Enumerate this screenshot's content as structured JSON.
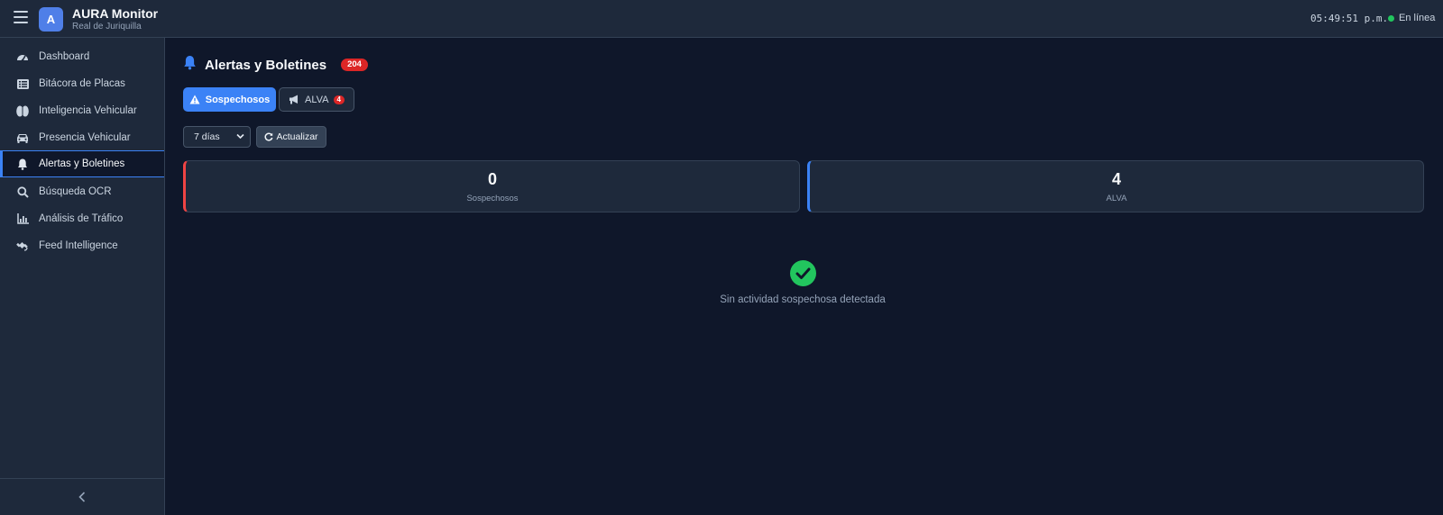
{
  "header": {
    "logo_letter": "A",
    "title": "AURA Monitor",
    "subtitle": "Real de Juriquilla",
    "clock": "05:49:51 p.m.",
    "status": "En línea",
    "status_color": "#22c55e"
  },
  "sidebar": {
    "items": [
      {
        "label": "Dashboard",
        "icon": "gauge-icon"
      },
      {
        "label": "Bitácora de Placas",
        "icon": "list-icon"
      },
      {
        "label": "Inteligencia Vehicular",
        "icon": "brain-icon"
      },
      {
        "label": "Presencia Vehicular",
        "icon": "car-icon"
      },
      {
        "label": "Alertas y Boletines",
        "icon": "bell-icon",
        "active": true
      },
      {
        "label": "Búsqueda OCR",
        "icon": "search-icon"
      },
      {
        "label": "Análisis de Tráfico",
        "icon": "chart-icon"
      },
      {
        "label": "Feed Intelligence",
        "icon": "satellite-icon"
      }
    ],
    "collapse_icon": "chevron-left-icon"
  },
  "main": {
    "title": "Alertas y Boletines",
    "title_badge": "204",
    "tabs": [
      {
        "label": "Sospechosos",
        "icon": "warning-icon",
        "active": true
      },
      {
        "label": "ALVA",
        "icon": "megaphone-icon",
        "badge": "4"
      }
    ],
    "period_select": {
      "value": "7 días"
    },
    "refresh_label": "Actualizar",
    "stats": [
      {
        "value": "0",
        "label": "Sospechosos",
        "accent": "#ef4444"
      },
      {
        "value": "4",
        "label": "ALVA",
        "accent": "#3b82f6"
      }
    ],
    "empty_message": "Sin actividad sospechosa detectada",
    "accent_color": "#3b82f6",
    "success_color": "#22c55e"
  }
}
